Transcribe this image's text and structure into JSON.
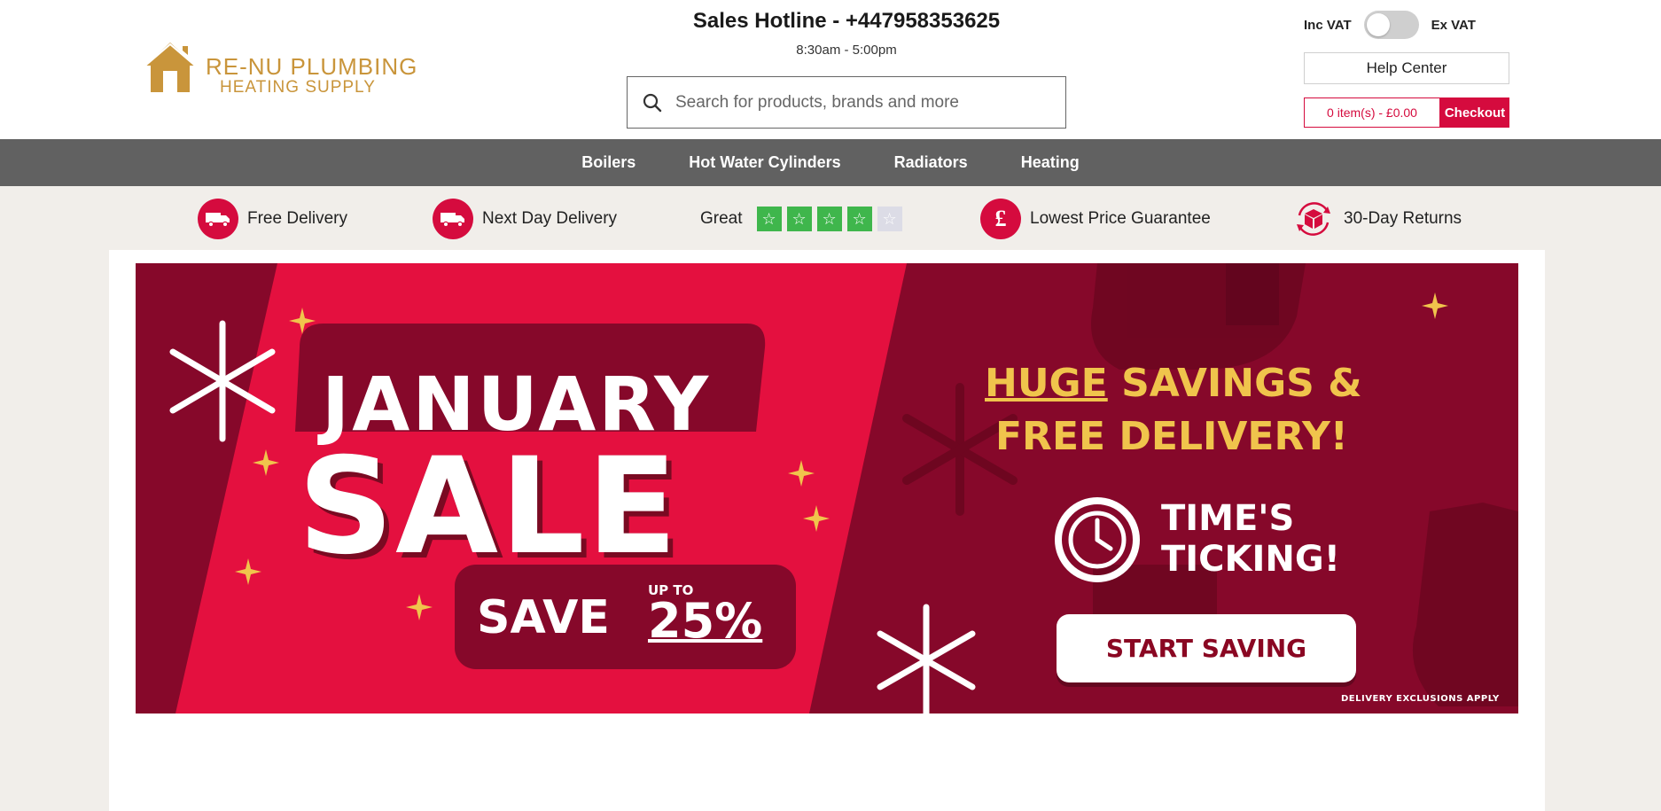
{
  "header": {
    "logo": {
      "line1": "RE-NU PLUMBING",
      "line2": "HEATING SUPPLY",
      "color": "#c9953b"
    },
    "hotline": "Sales Hotline - +447958353625",
    "hours": "8:30am - 5:00pm",
    "search": {
      "placeholder": "Search for products, brands and more",
      "icon": "search-icon"
    },
    "vat": {
      "inc_label": "Inc VAT",
      "ex_label": "Ex VAT",
      "mode": "Inc VAT"
    },
    "help_label": "Help Center",
    "cart": {
      "summary": "0 item(s) - £0.00",
      "checkout_label": "Checkout"
    }
  },
  "nav": {
    "items": [
      {
        "label": "Boilers"
      },
      {
        "label": "Hot Water Cylinders"
      },
      {
        "label": "Radiators"
      },
      {
        "label": "Heating"
      }
    ]
  },
  "usp": {
    "free_delivery": {
      "label": "Free Delivery",
      "icon": "delivery-truck-icon"
    },
    "next_day": {
      "label": "Next Day Delivery",
      "icon": "delivery-truck-icon"
    },
    "rating": {
      "label": "Great",
      "stars_filled": 4,
      "stars_total": 5
    },
    "price": {
      "label": "Lowest Price Guarantee",
      "icon": "pound-icon"
    },
    "returns": {
      "label": "30-Day Returns",
      "icon": "returns-box-icon"
    }
  },
  "banner": {
    "january": "JANUARY",
    "sale": "SALE",
    "save": "SAVE",
    "up_to": "UP TO",
    "percent": "25%",
    "huge": "HUGE",
    "savings": "SAVINGS &",
    "free_delivery": "FREE DELIVERY!",
    "times_1": "TIME'S",
    "times_2": "TICKING!",
    "cta": "START SAVING",
    "exclusions": "DELIVERY EXCLUSIONS APPLY"
  },
  "colors": {
    "brand_red": "#d50b3e",
    "nav_grey": "#616161",
    "banner_dark": "#86082a",
    "banner_red": "#e4103f",
    "gold": "#f0c44c",
    "star_green": "#3fb64c"
  }
}
